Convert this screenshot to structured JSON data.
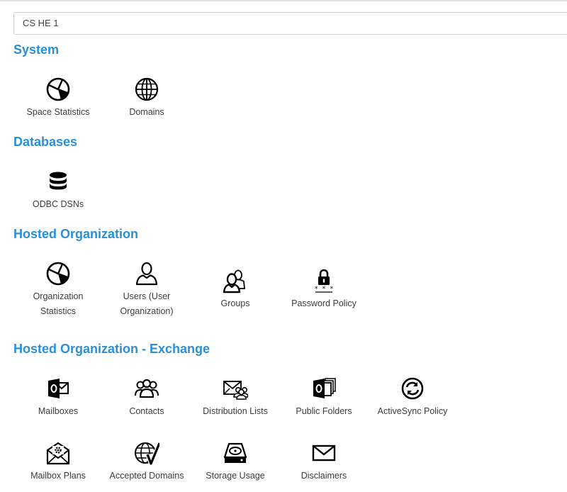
{
  "org_selector": {
    "value": "CS HE 1"
  },
  "sections": {
    "system": {
      "title": "System",
      "items": [
        {
          "label": "Space Statistics",
          "icon": "pie-chart-icon"
        },
        {
          "label": "Domains",
          "icon": "globe-icon"
        }
      ]
    },
    "databases": {
      "title": "Databases",
      "items": [
        {
          "label": "ODBC DSNs",
          "icon": "database-icon"
        }
      ]
    },
    "hosted_org": {
      "title": "Hosted Organization",
      "items": [
        {
          "label": "Organization Statistics",
          "icon": "pie-chart-icon"
        },
        {
          "label": "Users (User Organization)",
          "icon": "user-icon"
        },
        {
          "label": "Groups",
          "icon": "group-icon"
        },
        {
          "label": "Password Policy",
          "icon": "lock-icon"
        }
      ]
    },
    "exchange": {
      "title": "Hosted Organization - Exchange",
      "items": [
        {
          "label": "Mailboxes",
          "icon": "outlook-icon"
        },
        {
          "label": "Contacts",
          "icon": "contacts-icon"
        },
        {
          "label": "Distribution Lists",
          "icon": "distribution-list-icon"
        },
        {
          "label": "Public Folders",
          "icon": "public-folders-icon"
        },
        {
          "label": "ActiveSync Policy",
          "icon": "sync-icon"
        },
        {
          "label": "Mailbox Plans",
          "icon": "mailbox-plan-icon"
        },
        {
          "label": "Accepted Domains",
          "icon": "accepted-domain-icon"
        },
        {
          "label": "Storage Usage",
          "icon": "storage-icon"
        },
        {
          "label": "Disclaimers",
          "icon": "envelope-icon"
        }
      ]
    }
  }
}
